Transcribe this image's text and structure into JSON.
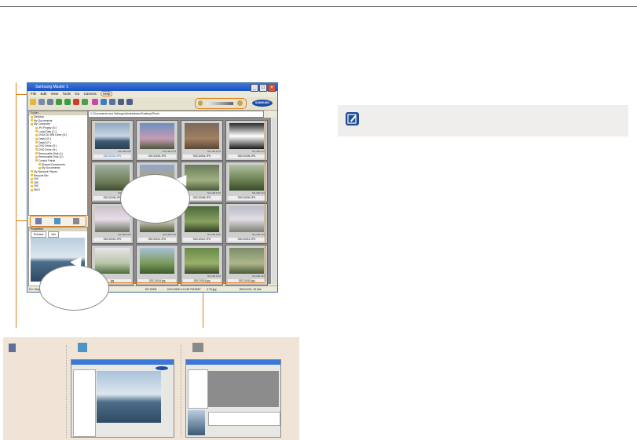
{
  "window": {
    "title": "Samsung Master 1",
    "menu": [
      "File",
      "Edit",
      "View",
      "Tools",
      "Go",
      "Camera",
      "Help"
    ],
    "logo": "SAMSUNG",
    "path": "C:\\Documents and Settings\\Administrator\\Desktop\\Photo"
  },
  "folders": {
    "header": "Folder",
    "items": [
      "Desktop",
      "My Documents",
      "My Computer",
      "3½ Floppy (A:)",
      "Local Disk (C:)",
      "DVD/CD-RW Drive (D:)",
      "Data1 (E:)",
      "Data2 (F:)",
      "DVD Drive (G:)",
      "DVD Drive (H:)",
      "Removable Disk (I:)",
      "Removable Disk (J:)",
      "Control Panel",
      "Shared Documents",
      "My Documents",
      "My Network Places",
      "Recycle Bin",
      "300",
      "450",
      "300",
      "0613"
    ]
  },
  "properties": {
    "header": "Properties",
    "tabs": [
      "Preview",
      "Info"
    ]
  },
  "thumbnails": [
    {
      "meta": "5/1,100 F3.5",
      "name": "SDC10001.JPG"
    },
    {
      "meta": "5/1,100 F3.5",
      "name": "SDC10002.JPG"
    },
    {
      "meta": "5/1,160 F3.5",
      "name": "SDC10004.JPG"
    },
    {
      "meta": "5/1,160 F3.5",
      "name": "SDC10005.JPG"
    },
    {
      "meta": "5/1,160 F3.5",
      "name": "SDC10006.JPG"
    },
    {
      "meta": "",
      "name": ""
    },
    {
      "meta": "5/1,100 F3.5",
      "name": "SDC10008.JPG"
    },
    {
      "meta": "5/1,160 F3.5",
      "name": "SDC10009.JPG"
    },
    {
      "meta": "5/1,160 F3.5",
      "name": "SDC10010.JPG"
    },
    {
      "meta": "5/1,100 F3.5",
      "name": "SDC10011.JPG"
    },
    {
      "meta": "5/1,160 F3.5",
      "name": "SDC10012.JPG"
    },
    {
      "meta": "5/1,100 F3.5",
      "name": "SDC10013.JPG"
    },
    {
      "meta": "",
      "name": "jpg"
    },
    {
      "meta": "",
      "name": "SDC10014.jpg"
    },
    {
      "meta": "5/1,100 F3.5",
      "name": "SDC10015.jpg"
    },
    {
      "meta": "5/1,100 F3.5",
      "name": "SDC10016.jpg"
    }
  ],
  "status": {
    "help": "For Help",
    "size": "8/2.53KB",
    "date": "6/21/2008 4:21:56 PM",
    "format": "BMP",
    "file": "4.78 jpg",
    "dims": "800x1200, 34 bits"
  },
  "colors": {
    "accent": "#e0801f",
    "note_bg": "#efeeec",
    "panel_bg": "#f0e4d7"
  },
  "icons": {
    "note": "pencil-note-icon"
  }
}
